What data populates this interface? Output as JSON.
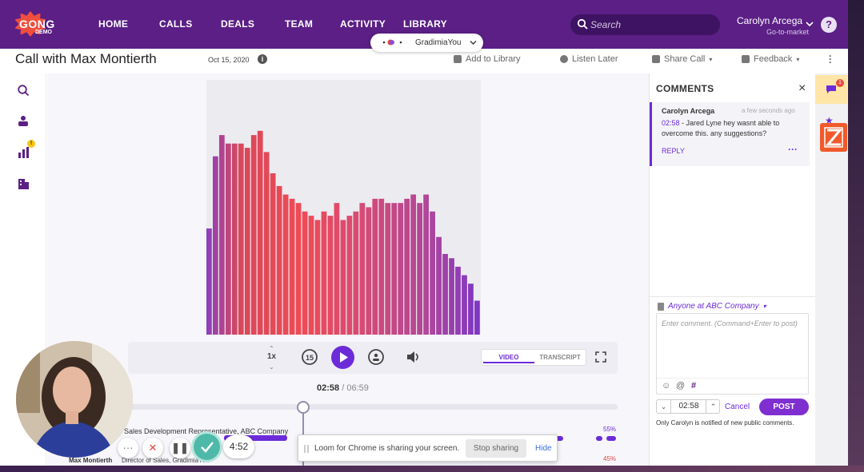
{
  "brand": {
    "logo_text": "GONG",
    "logo_sub": "DEMO",
    "accent": "#5b1f86",
    "primary": "#6c2bd9"
  },
  "nav": {
    "items": [
      "HOME",
      "CALLS",
      "DEALS",
      "TEAM",
      "ACTIVITY",
      "LIBRARY"
    ]
  },
  "search": {
    "placeholder": "Search"
  },
  "user": {
    "name": "Carolyn Arcega",
    "role": "Go-to-market"
  },
  "presence": {
    "label": "GradimiaYou"
  },
  "call": {
    "title": "Call with Max Montierth",
    "date": "Oct 15, 2020",
    "actions": {
      "add_library": "Add to Library",
      "listen_later": "Listen Later",
      "share": "Share Call",
      "feedback": "Feedback"
    }
  },
  "chart_data": {
    "type": "bar",
    "values": [
      25,
      42,
      47,
      45,
      45,
      45,
      44,
      47,
      48,
      43,
      38,
      35,
      33,
      32,
      31,
      29,
      28,
      27,
      29,
      28,
      31,
      27,
      28,
      29,
      31,
      30,
      32,
      32,
      31,
      31,
      31,
      32,
      33,
      31,
      33,
      29,
      23,
      19,
      18,
      16,
      14,
      12,
      8
    ]
  },
  "player": {
    "speed": "1x",
    "skip_back": "15",
    "current_time": "02:58",
    "duration": "06:59",
    "tab_video": "VIDEO",
    "tab_transcript": "TRANSCRIPT"
  },
  "speakers": [
    {
      "name": "",
      "title": "Sales Development Representative, ABC Company",
      "pct": "55%"
    },
    {
      "name": "Max Montierth",
      "title": "Director of Sales, GradimiaYou",
      "pct": "45%"
    }
  ],
  "loom": {
    "timer": "4:52",
    "message": "Loom for Chrome is sharing your screen.",
    "stop": "Stop sharing",
    "hide": "Hide"
  },
  "comments": {
    "title": "COMMENTS",
    "items": [
      {
        "author": "Carolyn Arcega",
        "ago": "a few seconds ago",
        "timestamp": "02:58",
        "text": " - Jared Lyne hey wasnt able to overcome this. any suggestions?",
        "reply": "REPLY"
      }
    ],
    "visibility": "Anyone at ABC Company",
    "placeholder": "Enter comment. (Command+Enter to post)",
    "ts_value": "02:58",
    "cancel": "Cancel",
    "post": "POST",
    "note": "Only Carolyn is notified of new public comments."
  },
  "rail": {
    "comment_badge": "1"
  },
  "sidebar": {
    "stats_badge": "!"
  }
}
